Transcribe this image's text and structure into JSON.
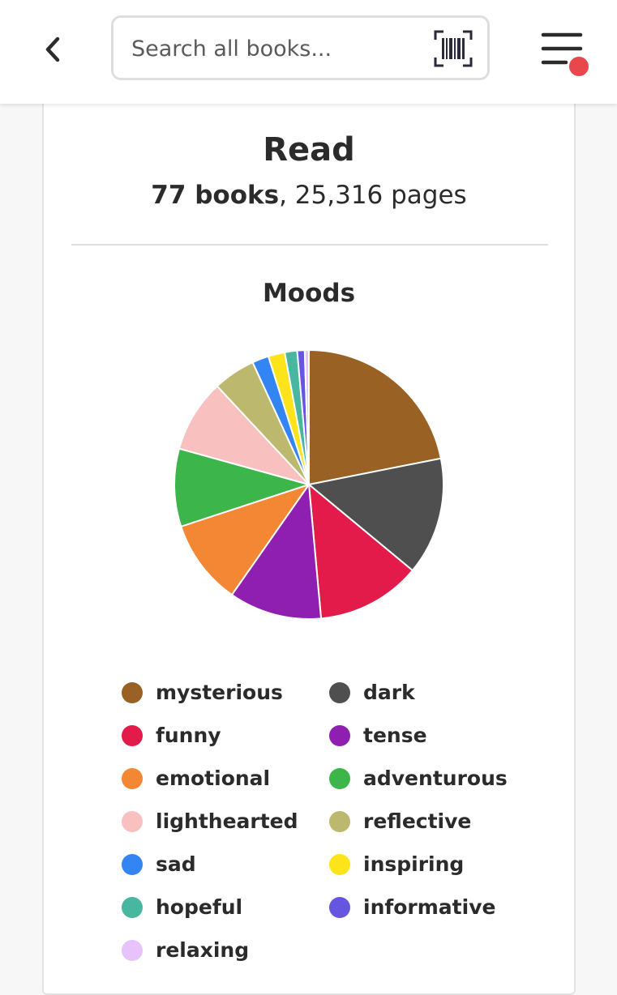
{
  "header": {
    "search_placeholder": "Search all books...",
    "back_icon": "chevron-left-icon",
    "barcode_icon": "barcode-scan-icon",
    "menu_icon": "menu-icon",
    "notification_color": "#e8474b"
  },
  "stats": {
    "title": "Read",
    "books": "77 books",
    "separator": ", ",
    "pages": "25,316 pages"
  },
  "chart_data": {
    "type": "pie",
    "title": "Moods",
    "legend_position": "bottom",
    "categories": [
      "mysterious",
      "dark",
      "funny",
      "tense",
      "emotional",
      "adventurous",
      "lighthearted",
      "reflective",
      "sad",
      "inspiring",
      "hopeful",
      "informative",
      "relaxing"
    ],
    "values": [
      22.0,
      14.2,
      12.6,
      11.2,
      10.3,
      9.4,
      8.8,
      5.1,
      2.0,
      2.0,
      1.5,
      0.9,
      0.5
    ],
    "colors": [
      "#996124",
      "#4f4f4f",
      "#e31b4a",
      "#8f1fb1",
      "#f38734",
      "#3cb54b",
      "#f9c0c0",
      "#bcb96e",
      "#3285f2",
      "#fde31a",
      "#48b79f",
      "#6555e0",
      "#e7c2fb"
    ]
  }
}
